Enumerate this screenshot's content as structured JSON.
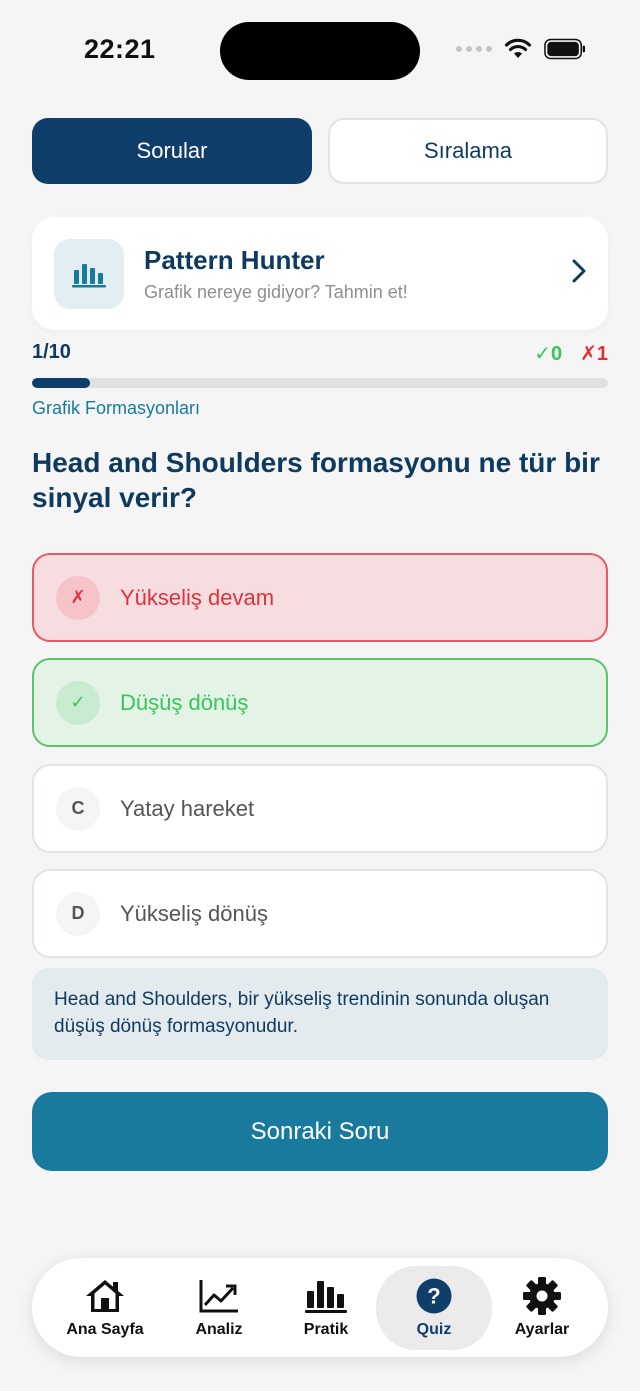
{
  "status_bar": {
    "time": "22:21"
  },
  "segments": {
    "questions": "Sorular",
    "ranking": "Sıralama"
  },
  "game": {
    "title": "Pattern Hunter",
    "subtitle": "Grafik nereye gidiyor? Tahmin et!"
  },
  "progress": {
    "count": "1/10",
    "current": 1,
    "total": 10,
    "correct": "✓0",
    "wrong": "✗1",
    "category": "Grafik Formasyonları"
  },
  "question": "Head and Shoulders formasyonu ne tür bir sinyal verir?",
  "options": [
    {
      "badge": "✗",
      "text": "Yükseliş devam",
      "state": "wrong"
    },
    {
      "badge": "✓",
      "text": "Düşüş dönüş",
      "state": "correct"
    },
    {
      "badge": "C",
      "text": "Yatay hareket",
      "state": "normal"
    },
    {
      "badge": "D",
      "text": "Yükseliş dönüş",
      "state": "normal"
    }
  ],
  "explanation": "Head and Shoulders, bir yükseliş trendinin sonunda oluşan düşüş dönüş formasyonudur.",
  "next_button": "Sonraki Soru",
  "tabbar": [
    {
      "label": "Ana Sayfa",
      "icon": "home-icon"
    },
    {
      "label": "Analiz",
      "icon": "line-chart-icon"
    },
    {
      "label": "Pratik",
      "icon": "bar-chart-icon"
    },
    {
      "label": "Quiz",
      "icon": "question-circle-icon",
      "active": true
    },
    {
      "label": "Ayarlar",
      "icon": "gear-icon"
    }
  ],
  "colors": {
    "primary": "#0f3e6b",
    "accent": "#1a7a9e",
    "correct": "#34c759",
    "wrong": "#e0313b"
  }
}
